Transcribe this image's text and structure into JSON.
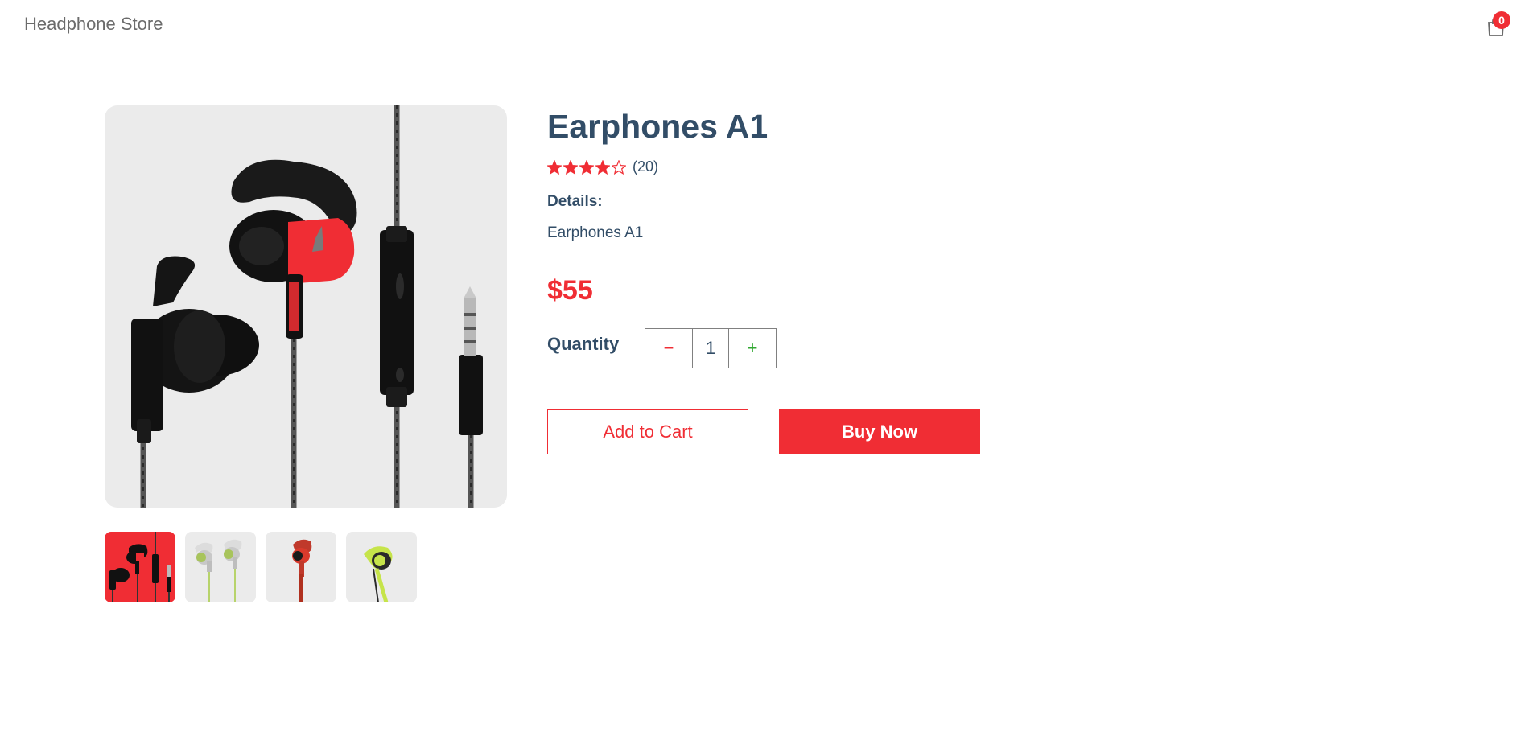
{
  "navbar": {
    "logo": "Headphone Store",
    "cart_count": "0",
    "cart_icon": "shopping-bag-icon"
  },
  "product": {
    "title": "Earphones A1",
    "rating": 4,
    "rating_max": 5,
    "review_count": "(20)",
    "details_heading": "Details:",
    "details_text": "Earphones A1",
    "price": "$55",
    "quantity_label": "Quantity",
    "quantity": "1",
    "minus_symbol": "−",
    "plus_symbol": "+",
    "add_to_cart": "Add to Cart",
    "buy_now": "Buy Now"
  },
  "gallery": {
    "selected_index": 0,
    "thumbnails": [
      "black-red-earphones",
      "white-lime-earphones",
      "red-earphone",
      "lime-earphone"
    ]
  },
  "colors": {
    "accent": "#f02d34",
    "text": "#324d67",
    "plus": "#31a831",
    "image_bg": "#ebebeb"
  }
}
